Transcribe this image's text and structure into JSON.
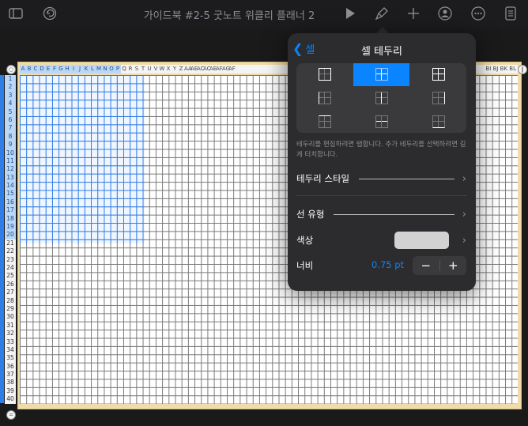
{
  "toolbar": {
    "title": "가이드북 #2-5 굿노트 위클리 플래너 2"
  },
  "sheet": {
    "columns": [
      "A",
      "B",
      "C",
      "D",
      "E",
      "F",
      "G",
      "H",
      "I",
      "J",
      "K",
      "L",
      "M",
      "N",
      "O",
      "P",
      "Q",
      "R",
      "S",
      "T",
      "U",
      "V",
      "W",
      "X",
      "Y",
      "Z",
      "AA",
      "AE",
      "AC",
      "AC",
      "AE",
      "AF",
      "AG",
      "AF"
    ],
    "selected_column_count": 16,
    "rows": [
      "1",
      "2",
      "3",
      "4",
      "5",
      "6",
      "7",
      "8",
      "9",
      "10",
      "11",
      "12",
      "13",
      "14",
      "15",
      "16",
      "17",
      "18",
      "19",
      "20",
      "21",
      "22",
      "23",
      "24",
      "25",
      "26",
      "27",
      "28",
      "29",
      "30",
      "31",
      "32",
      "33",
      "34",
      "35",
      "36",
      "37",
      "38",
      "39",
      "40"
    ],
    "selected_row_count": 20,
    "right_header_text": "BI BJ BK BL"
  },
  "popover": {
    "back_label": "셀",
    "title": "셀 테두리",
    "hint": "테두리를 편집하려면 탭합니다. 추가 테두리를 선택하려면 길게 터치합니다.",
    "border_style_label": "테두리 스타일",
    "line_type_label": "선 유형",
    "color_label": "색상",
    "color_value": "#d2d2d2",
    "width_label": "너비",
    "width_value": "0.75 pt",
    "minus_label": "−",
    "plus_label": "+",
    "accent_color": "#0a84ff"
  },
  "icons": [
    "sidebar-icon",
    "undo-icon",
    "play-icon",
    "brush-icon",
    "plus-icon",
    "share-collab-icon",
    "more-icon",
    "document-icon"
  ]
}
